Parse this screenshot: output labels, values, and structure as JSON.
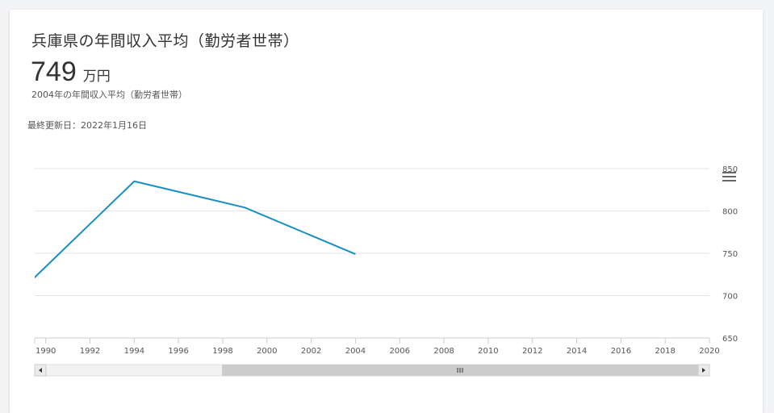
{
  "header": {
    "title": "兵庫県の年間収入平均（勤労者世帯）",
    "value": "749",
    "unit": "万円",
    "subnote": "2004年の年間収入平均（勤労者世帯）",
    "updated": "最終更新日：2022年1月16日"
  },
  "icons": {
    "menu": "hamburger-menu-icon",
    "scroll_left": "arrow-left-icon",
    "scroll_right": "arrow-right-icon",
    "scroll_grip": "grip-icon"
  },
  "colors": {
    "line": "#1a8fc4",
    "grid": "#e6e6e6",
    "scrollbar_thumb": "#cccccc",
    "scrollbar_track": "#f2f2f2"
  },
  "chart_data": {
    "type": "line",
    "x": [
      1989,
      1994,
      1999,
      2004
    ],
    "y": [
      709,
      835,
      804,
      749
    ],
    "title": "",
    "xlabel": "",
    "ylabel": "",
    "xlim": [
      1989.5,
      2020
    ],
    "ylim": [
      650,
      850
    ],
    "xticks": [
      1990,
      1992,
      1994,
      1996,
      1998,
      2000,
      2002,
      2004,
      2006,
      2008,
      2010,
      2012,
      2014,
      2016,
      2018,
      2020
    ],
    "yticks": [
      650,
      700,
      750,
      800,
      850
    ],
    "y_axis_side": "right",
    "grid": true
  }
}
